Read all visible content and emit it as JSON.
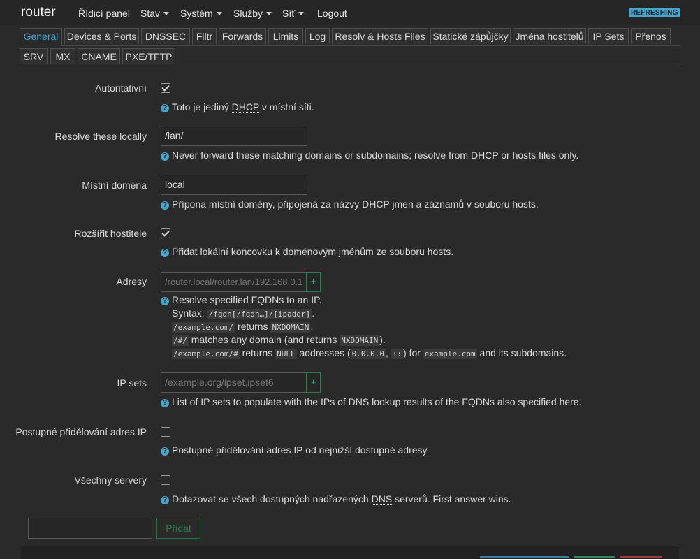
{
  "navbar": {
    "brand": "router",
    "items": [
      {
        "label": "Řídicí panel",
        "dropdown": false
      },
      {
        "label": "Stav",
        "dropdown": true
      },
      {
        "label": "Systém",
        "dropdown": true
      },
      {
        "label": "Služby",
        "dropdown": true
      },
      {
        "label": "Síť",
        "dropdown": true
      },
      {
        "label": "Logout",
        "dropdown": false
      }
    ],
    "badge": "REFRESHING"
  },
  "tabs_row1": [
    "General",
    "Devices & Ports",
    "DNSSEC",
    "Filtr",
    "Forwards",
    "Limits",
    "Log",
    "Resolv & Hosts Files",
    "Statické zápůjčky",
    "Jména hostitelů",
    "IP Sets",
    "Přenos"
  ],
  "tabs_row2": [
    "SRV",
    "MX",
    "CNAME",
    "PXE/TFTP"
  ],
  "active_tab": "General",
  "fields": {
    "authoritative": {
      "label": "Autoritativní",
      "checked": true,
      "help_pre": "Toto je jediný ",
      "help_abbr": "DHCP",
      "help_post": " v místní síti."
    },
    "resolve_locally": {
      "label": "Resolve these locally",
      "value": "/lan/",
      "help": "Never forward these matching domains or subdomains; resolve from DHCP or hosts files only."
    },
    "local_domain": {
      "label": "Místní doména",
      "value": "local",
      "help": "Přípona místní domény, připojená za názvy DHCP jmen a záznamů v souboru hosts."
    },
    "expand_hosts": {
      "label": "Rozšířit hostitele",
      "checked": true,
      "help": "Přidat lokální koncovku k doménovým jménům ze souboru hosts."
    },
    "addresses": {
      "label": "Adresy",
      "placeholder": "/router.local/router.lan/192.168.0.1",
      "add": "+",
      "help": "Resolve specified FQDNs to an IP.",
      "syntax_label": "Syntax:",
      "syntax_code": "/fqdn[/fqdn…]/[ipaddr]",
      "ex1_code": "/example.com/",
      "ex1_text": " returns ",
      "ex1_code2": "NXDOMAIN",
      "ex2_code": "/#/",
      "ex2_text": " matches any domain (and returns ",
      "ex2_code2": "NXDOMAIN",
      "ex2_end": ").",
      "ex3_code": "/example.com/#",
      "ex3_text": " returns ",
      "ex3_code2": "NULL",
      "ex3_text2": " addresses (",
      "ex3_code3": "0.0.0.0",
      "ex3_sep": ", ",
      "ex3_code4": "::",
      "ex3_text3": ") for ",
      "ex3_code5": "example.com",
      "ex3_text4": " and its subdomains."
    },
    "ip_sets": {
      "label": "IP sets",
      "placeholder": "/example.org/ipset,ipset6",
      "add": "+",
      "help": "List of IP sets to populate with the IPs of DNS lookup results of the FQDNs also specified here."
    },
    "sequential_ip": {
      "label": "Postupné přidělování adres IP",
      "checked": false,
      "help": "Postupné přidělování adres IP od nejnižší dostupné adresy."
    },
    "all_servers": {
      "label": "Všechny servery",
      "checked": false,
      "help_pre": "Dotazovat se všech dostupných nadřazených ",
      "help_abbr": "DNS",
      "help_post": " serverů. First answer wins."
    }
  },
  "bottom": {
    "add_label": "Přidat"
  },
  "colors": {
    "accent": "#3fa3d6",
    "badge": "#4ba5c8",
    "success": "#3cb37a"
  }
}
